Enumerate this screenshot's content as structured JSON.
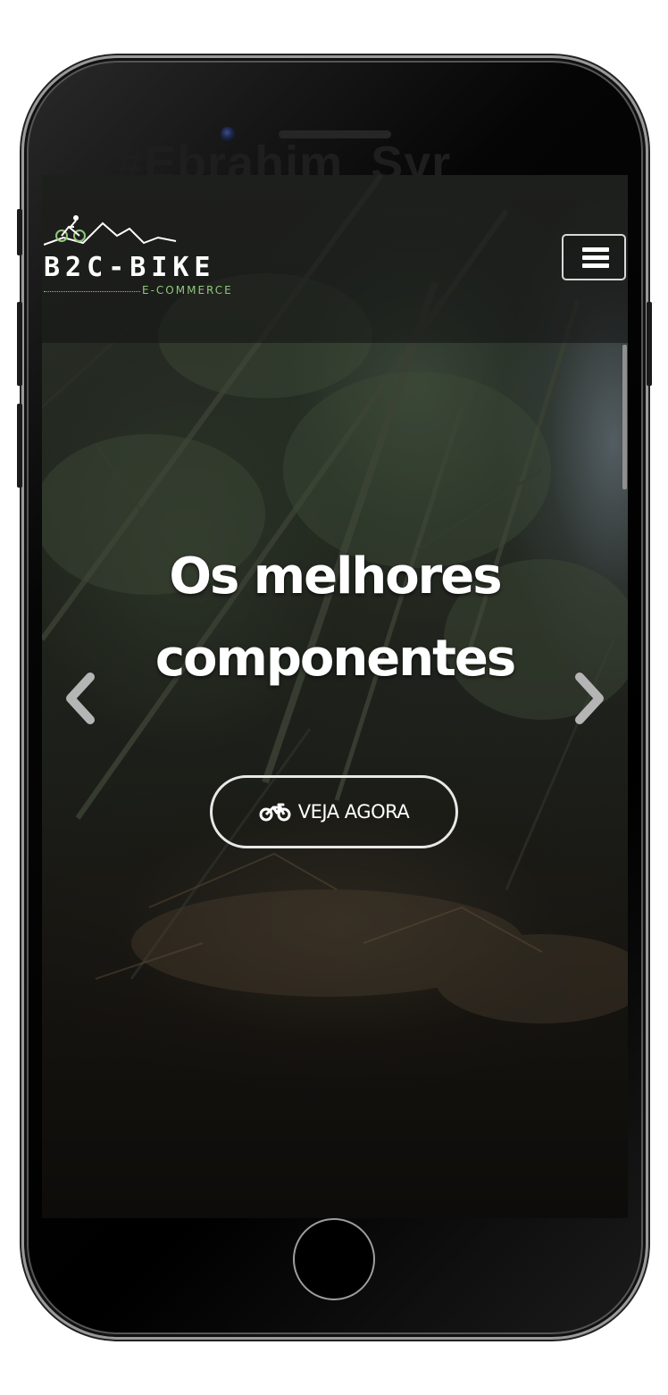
{
  "device": {
    "ghost_text": "#Ebrahim_Syr"
  },
  "navbar": {
    "logo": {
      "wordmark": "B2C-BIKE",
      "tagline": "E-COMMERCE",
      "accent_color": "#8fc77a"
    },
    "menu_icon": "hamburger-icon"
  },
  "hero": {
    "title_line1": "Os melhores",
    "title_line2": "componentes",
    "cta": {
      "icon": "motorcycle-icon",
      "label": "VEJA AGORA"
    },
    "prev_icon": "chevron-left-icon",
    "next_icon": "chevron-right-icon"
  }
}
